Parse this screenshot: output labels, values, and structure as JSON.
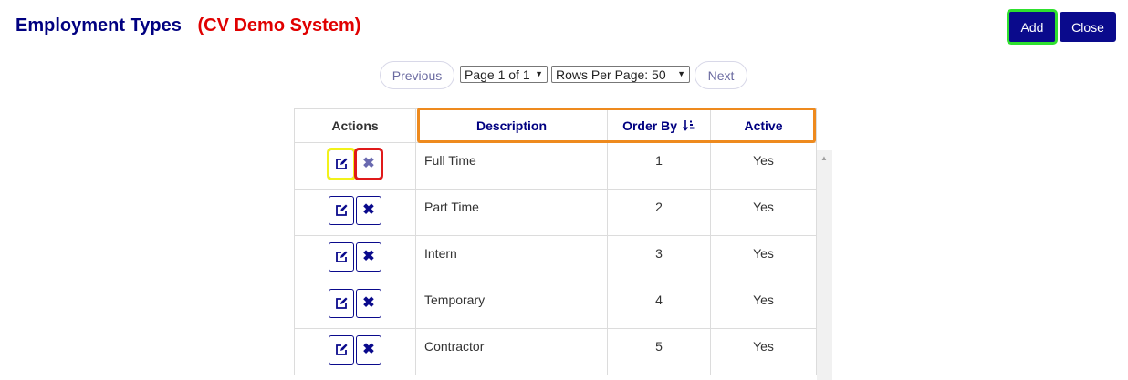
{
  "header": {
    "title": "Employment Types",
    "subtitle": "(CV Demo System)"
  },
  "toolbar": {
    "add_label": "Add",
    "close_label": "Close"
  },
  "pager": {
    "previous_label": "Previous",
    "next_label": "Next",
    "page_value": "Page 1 of 1",
    "rows_value": "Rows Per Page: 50"
  },
  "table": {
    "columns": {
      "actions": "Actions",
      "description": "Description",
      "order_by": "Order By",
      "active": "Active"
    },
    "rows": [
      {
        "description": "Full Time",
        "order": "1",
        "active": "Yes"
      },
      {
        "description": "Part Time",
        "order": "2",
        "active": "Yes"
      },
      {
        "description": "Intern",
        "order": "3",
        "active": "Yes"
      },
      {
        "description": "Temporary",
        "order": "4",
        "active": "Yes"
      },
      {
        "description": "Contractor",
        "order": "5",
        "active": "Yes"
      }
    ]
  },
  "icons": {
    "edit": "edit-icon",
    "delete": "close-x-icon",
    "sort": "sort-ascending-icon",
    "scroll": "scroll-up-arrow-icon"
  },
  "colors": {
    "brand_navy": "#0a0a8c",
    "title_red": "#e00000",
    "highlight_green": "#2ee02e",
    "highlight_yellow": "#f2f21a",
    "highlight_red": "#e01a1a",
    "highlight_orange": "#ee8a1e"
  }
}
